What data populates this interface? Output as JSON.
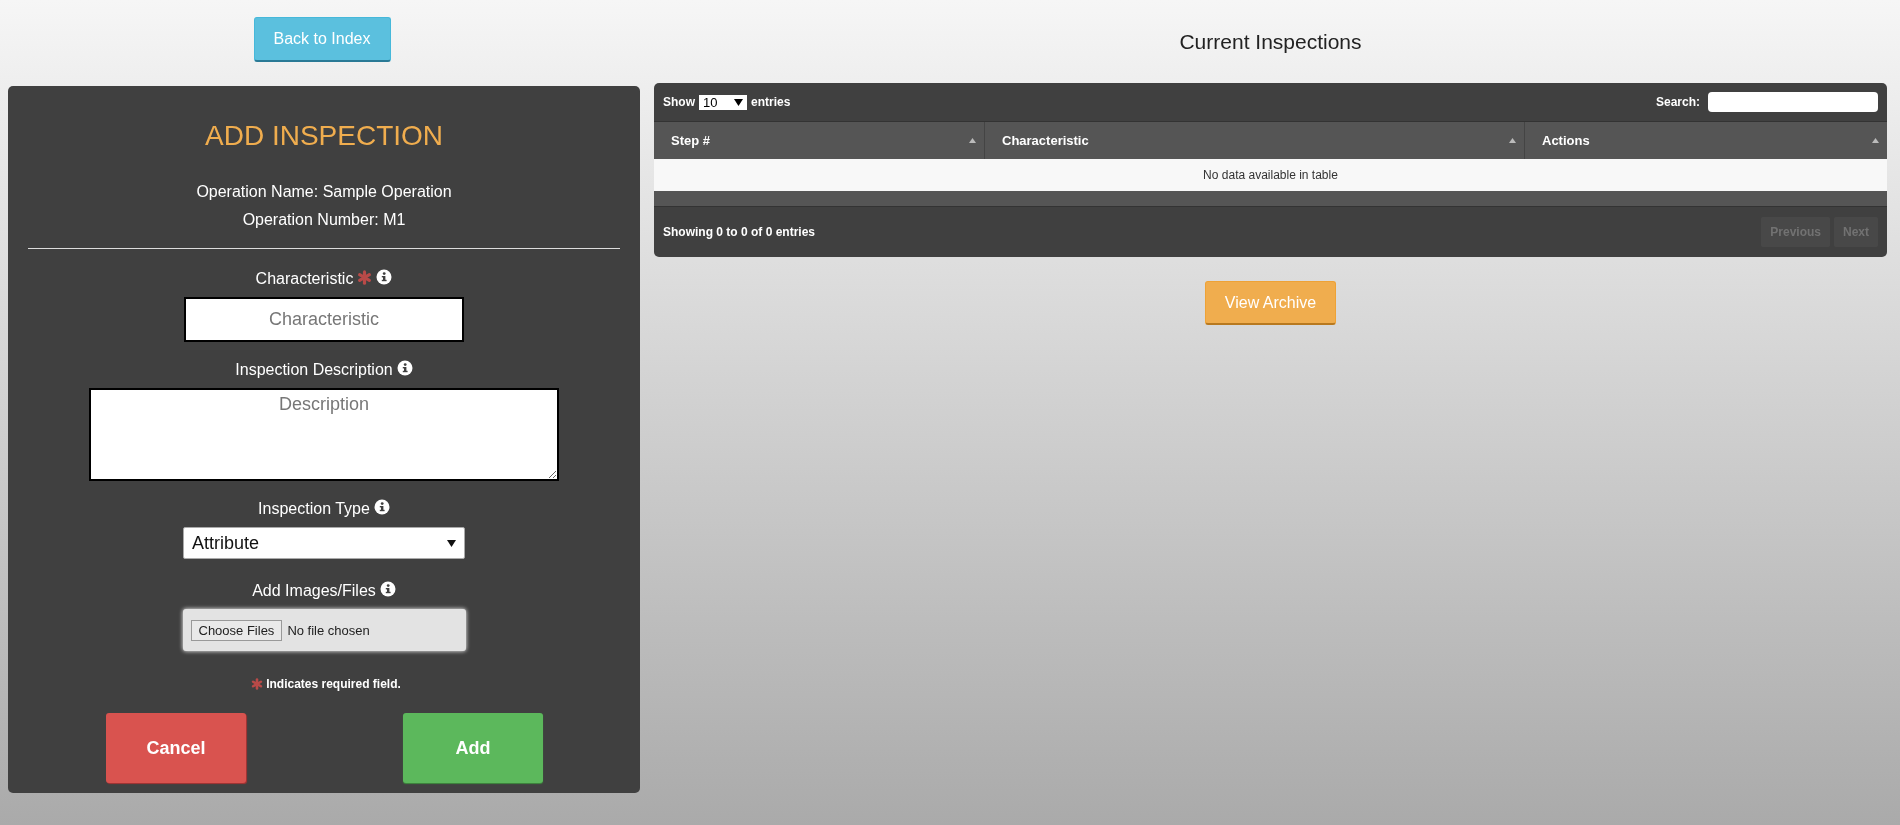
{
  "back_button": "Back to Index",
  "form": {
    "title": "ADD INSPECTION",
    "operation_name": "Operation Name: Sample Operation",
    "operation_number": "Operation Number: M1",
    "fields": [
      {
        "kind": "text",
        "label": "Characteristic",
        "required": true,
        "placeholder": "Characteristic"
      },
      {
        "kind": "textarea",
        "label": "Inspection Description",
        "required": false,
        "placeholder": "Description"
      },
      {
        "kind": "select",
        "label": "Inspection Type",
        "required": false,
        "value": "Attribute"
      },
      {
        "kind": "file",
        "label": "Add Images/Files",
        "required": false,
        "button": "Choose Files",
        "value": "No file chosen"
      }
    ],
    "required_note": "Indicates required field.",
    "buttons": [
      {
        "kind": "cancel",
        "label": "Cancel"
      },
      {
        "kind": "add",
        "label": "Add"
      }
    ]
  },
  "inspections": {
    "title": "Current Inspections",
    "show_label": "Show",
    "length_value": "10",
    "entries_label": "entries",
    "search_label": "Search:",
    "columns": [
      "Step #",
      "Characteristic",
      "Actions"
    ],
    "empty_message": "No data available in table",
    "info": "Showing 0 to 0 of 0 entries",
    "pagination": [
      {
        "label": "Previous",
        "disabled": true
      },
      {
        "label": "Next",
        "disabled": true
      }
    ]
  },
  "archive_button": "View Archive"
}
